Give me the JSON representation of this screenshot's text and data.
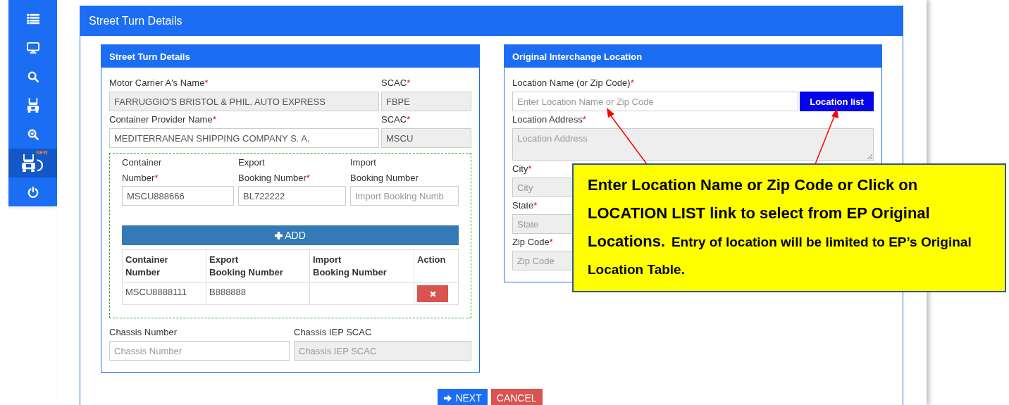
{
  "sidebar": {
    "items": [
      {
        "kind": "list",
        "selected": false
      },
      {
        "kind": "monitor",
        "selected": false
      },
      {
        "kind": "search",
        "selected": false
      },
      {
        "kind": "truck",
        "selected": false
      },
      {
        "kind": "zoom",
        "selected": false
      },
      {
        "kind": "truck-return",
        "selected": true,
        "badge": "NEW"
      },
      {
        "kind": "power",
        "selected": false
      }
    ]
  },
  "page": {
    "title": "Street Turn Details"
  },
  "left_panel": {
    "title": "Street Turn Details",
    "rows": [
      [
        {
          "label": "Motor Carrier A's Name",
          "required_mark": "*",
          "value": "FARRUGGIO'S BRISTOL & PHIL. AUTO EXPRESS",
          "disabled": true
        },
        {
          "label": "SCAC",
          "required_mark": "*",
          "value": "FBPE",
          "disabled": true
        }
      ],
      [
        {
          "label": "Container Provider Name",
          "required_mark": "*",
          "value": "MEDITERRANEAN SHIPPING COMPANY S. A.",
          "disabled": false
        },
        {
          "label": "SCAC",
          "required_mark": "*",
          "value": "MSCU",
          "disabled": true
        }
      ]
    ],
    "container_fields": [
      {
        "label_top": "Container",
        "label": "Number",
        "required_mark": "*",
        "value": "MSCU888666",
        "disabled": false
      },
      {
        "label_top": "Export",
        "label": "Booking Number",
        "required_mark": "*",
        "value": "BL722222",
        "disabled": false
      },
      {
        "label_top": "Import",
        "label": "Booking Number",
        "placeholder": "Import Booking Numb",
        "disabled": false
      }
    ],
    "add_button": "ADD",
    "table": {
      "columns": [
        "Container\nNumber",
        "Export\nBooking Number",
        "Import\nBooking Number",
        "Action"
      ],
      "rows": [
        {
          "container_number": "MSCU8888111",
          "export_booking_number": "B888888",
          "import_booking_number": ""
        }
      ]
    },
    "chassis": [
      {
        "label": "Chassis Number",
        "placeholder": "Chassis Number",
        "disabled": false
      },
      {
        "label": "Chassis IEP SCAC",
        "placeholder": "Chassis IEP SCAC",
        "disabled": true
      }
    ]
  },
  "right_panel": {
    "title": "Original Interchange Location",
    "location": {
      "label": "Location Name (or Zip Code)",
      "required_mark": "*",
      "placeholder": "Enter Location Name or Zip Code",
      "button": "Location list"
    },
    "address": {
      "label": "Location Address",
      "required_mark": "*",
      "placeholder": "Location Address",
      "disabled": true
    },
    "fields": [
      {
        "label": "City",
        "required_mark": "*",
        "placeholder": "City",
        "disabled": true
      },
      {
        "label": "State",
        "required_mark": "*",
        "placeholder": "State",
        "disabled": true
      },
      {
        "label": "Zip Code",
        "required_mark": "*",
        "placeholder": "Zip Code",
        "disabled": true
      }
    ]
  },
  "callout": {
    "lead": "Enter Location Name or Zip Code or Click on LOCATION LIST link to select from EP Original Locations.",
    "note": "Entry of location will be limited to EP’s Original Location Table."
  },
  "buttons": {
    "next": "NEXT",
    "cancel": "CANCEL"
  }
}
